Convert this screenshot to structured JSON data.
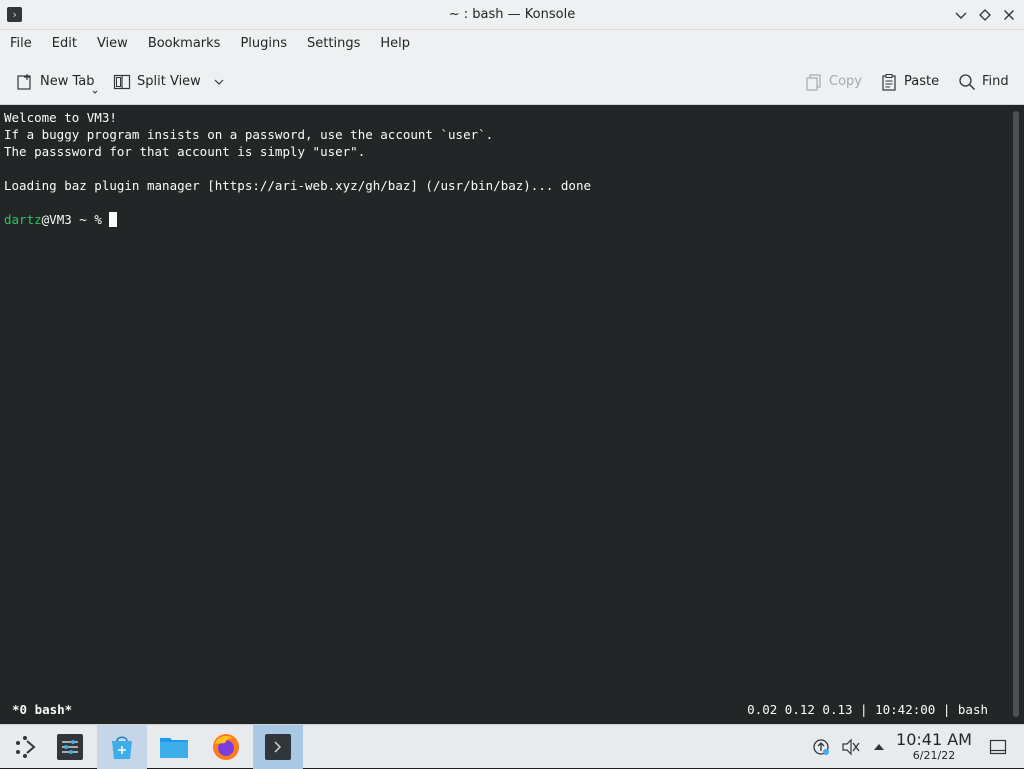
{
  "window": {
    "title": "~ : bash — Konsole"
  },
  "menubar": {
    "items": [
      "File",
      "Edit",
      "View",
      "Bookmarks",
      "Plugins",
      "Settings",
      "Help"
    ]
  },
  "toolbar": {
    "new_tab": "New Tab",
    "split_view": "Split View",
    "copy": "Copy",
    "paste": "Paste",
    "find": "Find"
  },
  "terminal": {
    "lines": [
      "Welcome to VM3!",
      "If a buggy program insists on a password, use the account `user`.",
      "The passsword for that account is simply \"user\".",
      "",
      "Loading baz plugin manager [https://ari-web.xyz/gh/baz] (/usr/bin/baz)... done",
      ""
    ],
    "prompt_user": "dartz",
    "prompt_rest": "@VM3 ~ % "
  },
  "statusline": {
    "left": "*0 bash*",
    "right": "0.02 0.12 0.13 | 10:42:00 | bash"
  },
  "taskbar": {
    "time": "10:41 AM",
    "date": "6/21/22"
  },
  "colors": {
    "terminal_bg": "#232627",
    "terminal_fg": "#fcfcfc",
    "prompt_user": "#2ec25a",
    "chrome_bg": "#eff0f1"
  }
}
